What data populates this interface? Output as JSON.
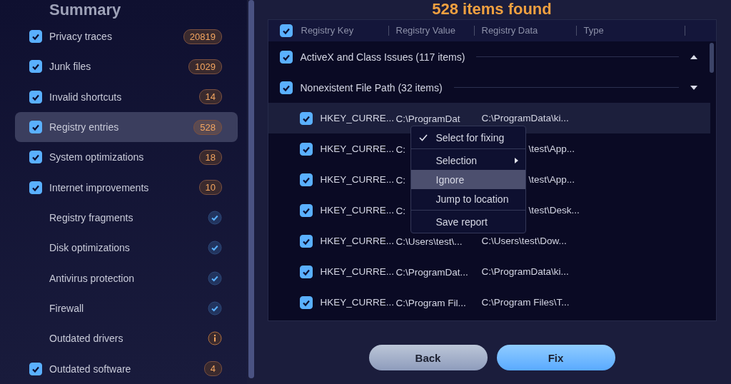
{
  "sidebar": {
    "title": "Summary",
    "items": [
      {
        "kind": "count",
        "label": "Privacy traces",
        "checked": true,
        "count": "20819",
        "selected": false
      },
      {
        "kind": "count",
        "label": "Junk files",
        "checked": true,
        "count": "1029",
        "selected": false
      },
      {
        "kind": "count",
        "label": "Invalid shortcuts",
        "checked": true,
        "count": "14",
        "selected": false
      },
      {
        "kind": "count",
        "label": "Registry entries",
        "checked": true,
        "count": "528",
        "selected": true
      },
      {
        "kind": "count",
        "label": "System optimizations",
        "checked": true,
        "count": "18",
        "selected": false
      },
      {
        "kind": "count",
        "label": "Internet improvements",
        "checked": true,
        "count": "10",
        "selected": false
      },
      {
        "kind": "status",
        "label": "Registry fragments",
        "warning": false,
        "selected": false
      },
      {
        "kind": "status",
        "label": "Disk optimizations",
        "warning": false,
        "selected": false
      },
      {
        "kind": "status",
        "label": "Antivirus protection",
        "warning": false,
        "selected": false
      },
      {
        "kind": "status",
        "label": "Firewall",
        "warning": false,
        "selected": false
      },
      {
        "kind": "status",
        "label": "Outdated drivers",
        "warning": true,
        "selected": false
      },
      {
        "kind": "count",
        "label": "Outdated software",
        "checked": true,
        "count": "4",
        "selected": false
      }
    ]
  },
  "heading": "528 items found",
  "table": {
    "all_checked": true,
    "columns": [
      "Registry Key",
      "Registry Value",
      "Registry Data",
      "Type"
    ],
    "groups": [
      {
        "label": "ActiveX and Class Issues (117 items)",
        "checked": true,
        "expanded": false
      },
      {
        "label": "Nonexistent File Path (32 items)",
        "checked": true,
        "expanded": true,
        "rows": [
          {
            "checked": true,
            "selected": true,
            "key": "HKEY_CURRE...",
            "value": "C:\\ProgramDat",
            "data": "C:\\ProgramData\\ki...",
            "data_partly_hidden": false
          },
          {
            "checked": true,
            "selected": false,
            "key": "HKEY_CURRE...",
            "value": "C:",
            "data": "\\test\\App...",
            "data_partly_hidden": true
          },
          {
            "checked": true,
            "selected": false,
            "key": "HKEY_CURRE...",
            "value": "C:",
            "data": "\\test\\App...",
            "data_partly_hidden": true
          },
          {
            "checked": true,
            "selected": false,
            "key": "HKEY_CURRE...",
            "value": "C:",
            "data": "\\test\\Desk...",
            "data_partly_hidden": true
          },
          {
            "checked": true,
            "selected": false,
            "key": "HKEY_CURRE...",
            "value": "C:\\Users\\test\\...",
            "data": "C:\\Users\\test\\Dow...",
            "data_partly_hidden": false
          },
          {
            "checked": true,
            "selected": false,
            "key": "HKEY_CURRE...",
            "value": "C:\\ProgramDat...",
            "data": "C:\\ProgramData\\ki...",
            "data_partly_hidden": false
          },
          {
            "checked": true,
            "selected": false,
            "key": "HKEY_CURRE...",
            "value": "C:\\Program Fil...",
            "data": "C:\\Program Files\\T...",
            "data_partly_hidden": false
          }
        ]
      }
    ]
  },
  "context_menu": {
    "sections": [
      [
        {
          "label": "Select for fixing",
          "checked": true,
          "submenu": false,
          "selected": false
        }
      ],
      [
        {
          "label": "Selection",
          "checked": false,
          "submenu": true,
          "selected": false
        },
        {
          "label": "Ignore",
          "checked": false,
          "submenu": false,
          "selected": true
        },
        {
          "label": "Jump to location",
          "checked": false,
          "submenu": false,
          "selected": false
        }
      ],
      [
        {
          "label": "Save report",
          "checked": false,
          "submenu": false,
          "selected": false
        }
      ]
    ]
  },
  "buttons": [
    {
      "label": "Back",
      "kind": "secondary"
    },
    {
      "label": "Fix",
      "kind": "primary"
    }
  ]
}
